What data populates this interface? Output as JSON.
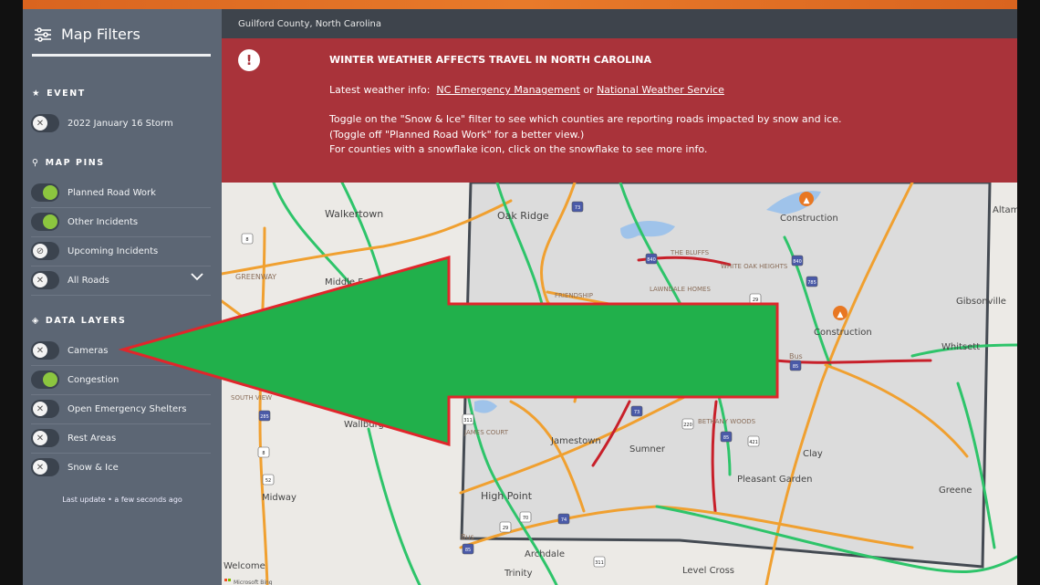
{
  "header": {
    "location": "Guilford County, North Carolina"
  },
  "sidebar": {
    "title": "Map Filters",
    "sections": [
      {
        "label": "EVENT",
        "icon": "star-icon",
        "items": [
          {
            "label": "2022 January 16 Storm",
            "state": "off"
          }
        ]
      },
      {
        "label": "MAP PINS",
        "icon": "map-pin-icon",
        "items": [
          {
            "label": "Planned Road Work",
            "state": "on"
          },
          {
            "label": "Other Incidents",
            "state": "on"
          },
          {
            "label": "Upcoming Incidents",
            "state": "hidden"
          },
          {
            "label": "All Roads",
            "state": "off"
          }
        ]
      },
      {
        "label": "DATA LAYERS",
        "icon": "layers-icon",
        "items": [
          {
            "label": "Cameras",
            "state": "off"
          },
          {
            "label": "Congestion",
            "state": "on"
          },
          {
            "label": "Open Emergency Shelters",
            "state": "off"
          },
          {
            "label": "Rest Areas",
            "state": "off"
          },
          {
            "label": "Snow & Ice",
            "state": "off"
          }
        ]
      }
    ],
    "last_update": "Last update • a few seconds ago"
  },
  "banner": {
    "title": "WINTER WEATHER AFFECTS TRAVEL IN NORTH CAROLINA",
    "info_prefix": "Latest weather info:",
    "link1": "NC Emergency Management",
    "or": "or",
    "link2": "National Weather Service",
    "line1": "Toggle on the \"Snow & Ice\" filter to see which counties are reporting roads impacted by snow and ice.",
    "line2": "(Toggle off \"Planned Road Work\" for a better view.)",
    "line3": "For counties with a snowflake icon, click on the snowflake to see more info.",
    "color": "#a9333a"
  },
  "map": {
    "places": [
      "Walkertown",
      "Oak Ridge",
      "Construction",
      "Altam",
      "GREENWAY",
      "Middle Fork",
      "THE BLUFFS",
      "WHITE OAK HEIGHTS",
      "FRIENDSHIP",
      "LAWNDALE HOMES",
      "Gibsonville",
      "Construction",
      "Whitsett",
      "SOUTH VIEW",
      "Wallburg",
      "JAMES COURT",
      "Jamestown",
      "Sumner",
      "BETHANY WOODS",
      "Clay",
      "Pleasant Garden",
      "Greene",
      "High Point",
      "Midway",
      "Archdale",
      "Trinity",
      "Level Cross",
      "Welcome",
      "Bus",
      "Bus"
    ],
    "shields": [
      "73",
      "840",
      "840",
      "785",
      "29",
      "85",
      "73",
      "220",
      "85",
      "421",
      "311",
      "70",
      "74",
      "29",
      "85",
      "311",
      "8",
      "285",
      "8",
      "52"
    ],
    "attribution": "Microsoft Bing",
    "road_colors": {
      "clear": "#2ec46a",
      "slow": "#f0a030",
      "heavy": "#c8202a"
    }
  },
  "annotation": {
    "arrow_fill": "#21b04b",
    "arrow_stroke": "#e0262b"
  }
}
